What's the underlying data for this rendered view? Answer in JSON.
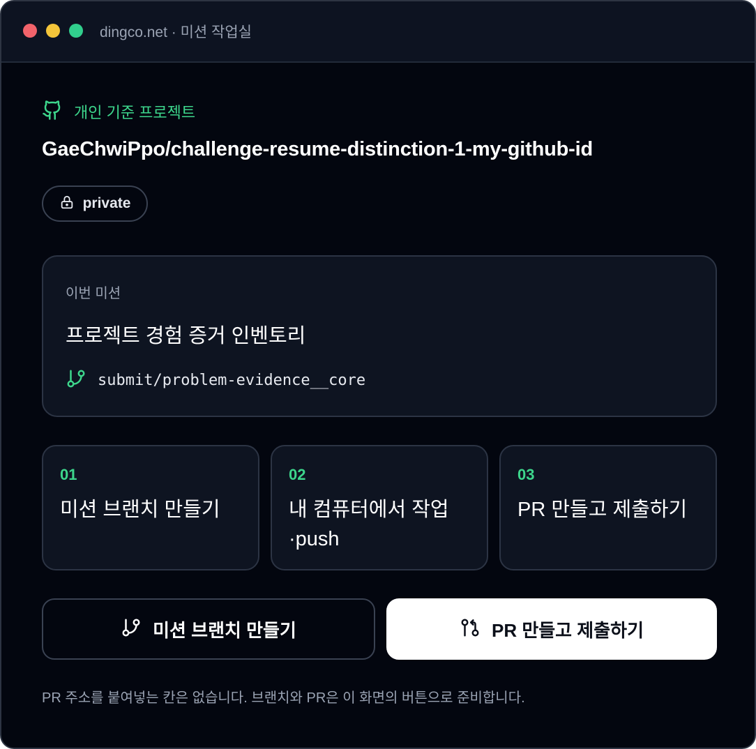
{
  "window": {
    "title": "dingco.net · 미션 작업실"
  },
  "header": {
    "eyebrow": "개인 기준 프로젝트",
    "repo_name": "GaeChwiPpo/challenge-resume-distinction-1-my-github-id",
    "visibility": "private"
  },
  "mission": {
    "label": "이번 미션",
    "title": "프로젝트 경험 증거 인벤토리",
    "branch": "submit/problem-evidence__core"
  },
  "steps": [
    {
      "number": "01",
      "title": "미션 브랜치 만들기"
    },
    {
      "number": "02",
      "title": "내 컴퓨터에서 작업·push"
    },
    {
      "number": "03",
      "title": "PR 만들고 제출하기"
    }
  ],
  "actions": {
    "create_branch": "미션 브랜치 만들기",
    "create_pr": "PR 만들고 제출하기"
  },
  "footnote": "PR 주소를 붙여넣는 칸은 없습니다. 브랜치와 PR은 이 화면의 버튼으로 준비합니다.",
  "icons": {
    "window_dots": [
      "close-dot",
      "minimize-dot",
      "maximize-dot"
    ],
    "eyebrow": "github-icon",
    "visibility": "lock-icon",
    "branch": "git-branch-icon",
    "pull_request": "git-pull-request-icon"
  },
  "colors": {
    "background": "#03060f",
    "titlebar": "#0d1321",
    "card": "#0e1421",
    "accent": "#3dd68c",
    "dot_red": "#f2636b",
    "dot_yellow": "#f4c53a",
    "dot_green": "#31cf8d",
    "primary_button": "#ffffff"
  }
}
